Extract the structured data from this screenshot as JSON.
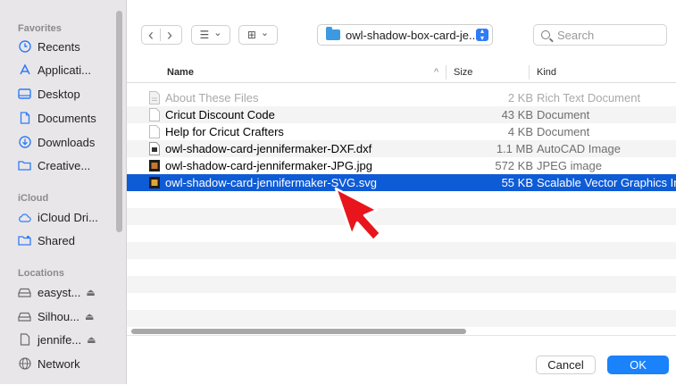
{
  "sidebar": {
    "favorites_heading": "Favorites",
    "favorites": [
      {
        "label": "Recents",
        "icon": "clock-icon"
      },
      {
        "label": "Applicati...",
        "icon": "apps-icon"
      },
      {
        "label": "Desktop",
        "icon": "desktop-icon"
      },
      {
        "label": "Documents",
        "icon": "document-icon"
      },
      {
        "label": "Downloads",
        "icon": "download-icon"
      },
      {
        "label": "Creative...",
        "icon": "folder-icon"
      }
    ],
    "icloud_heading": "iCloud",
    "icloud": [
      {
        "label": "iCloud Dri...",
        "icon": "cloud-icon"
      },
      {
        "label": "Shared",
        "icon": "shared-folder-icon"
      }
    ],
    "locations_heading": "Locations",
    "locations": [
      {
        "label": "easyst...",
        "icon": "drive-icon",
        "eject": "⏏"
      },
      {
        "label": "Silhou...",
        "icon": "drive-icon",
        "eject": "⏏"
      },
      {
        "label": "jennife...",
        "icon": "document-icon",
        "eject": "⏏"
      },
      {
        "label": "Network",
        "icon": "globe-icon"
      }
    ]
  },
  "toolbar": {
    "back_icon": "‹",
    "forward_icon": "›",
    "list_view_icon": "☰",
    "grid_view_icon": "⊞",
    "chevron": "⌄",
    "path_label": "owl-shadow-box-card-je...",
    "search_placeholder": "Search"
  },
  "columns": {
    "name": "Name",
    "size": "Size",
    "kind": "Kind",
    "sort_indicator": "^"
  },
  "files": [
    {
      "name": "About These Files",
      "size": "2 KB",
      "kind": "Rich Text Document",
      "icon": "text-file-icon",
      "dim": true
    },
    {
      "name": "Cricut Discount Code",
      "size": "43 KB",
      "kind": "Document",
      "icon": "blank-file-icon"
    },
    {
      "name": "Help for Cricut Crafters",
      "size": "4 KB",
      "kind": "Document",
      "icon": "blank-file-icon"
    },
    {
      "name": "owl-shadow-card-jennifermaker-DXF.dxf",
      "size": "1.1 MB",
      "kind": "AutoCAD Image",
      "icon": "dxf-file-icon"
    },
    {
      "name": "owl-shadow-card-jennifermaker-JPG.jpg",
      "size": "572 KB",
      "kind": "JPEG image",
      "icon": "jpg-file-icon"
    },
    {
      "name": "owl-shadow-card-jennifermaker-SVG.svg",
      "size": "55 KB",
      "kind": "Scalable Vector Graphics In",
      "icon": "svg-file-icon",
      "selected": true
    }
  ],
  "footer": {
    "cancel_label": "Cancel",
    "ok_label": "OK"
  },
  "colors": {
    "selection": "#0e5bd6",
    "ok_button": "#1a82fb",
    "annotation_arrow": "#e8151c"
  }
}
